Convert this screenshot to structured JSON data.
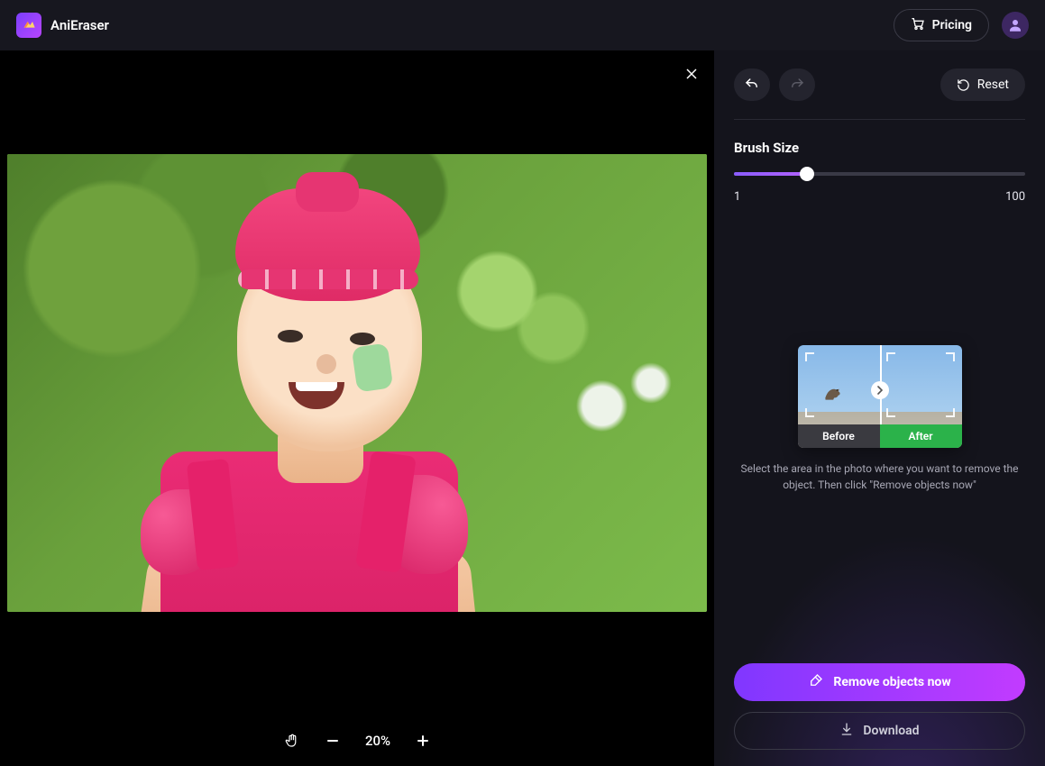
{
  "header": {
    "app_name": "AniEraser",
    "pricing_label": "Pricing"
  },
  "canvas": {
    "zoom_text": "20%"
  },
  "panel": {
    "reset_label": "Reset",
    "brush_label": "Brush Size",
    "brush_min": "1",
    "brush_max": "100",
    "brush_value": 25,
    "demo_before_label": "Before",
    "demo_after_label": "After",
    "help_text": "Select the area in the photo where you want to remove the object. Then click \"Remove objects now\"",
    "remove_label": "Remove objects now",
    "download_label": "Download"
  },
  "colors": {
    "accent_gradient_start": "#8037ff",
    "accent_gradient_end": "#c23bff"
  }
}
